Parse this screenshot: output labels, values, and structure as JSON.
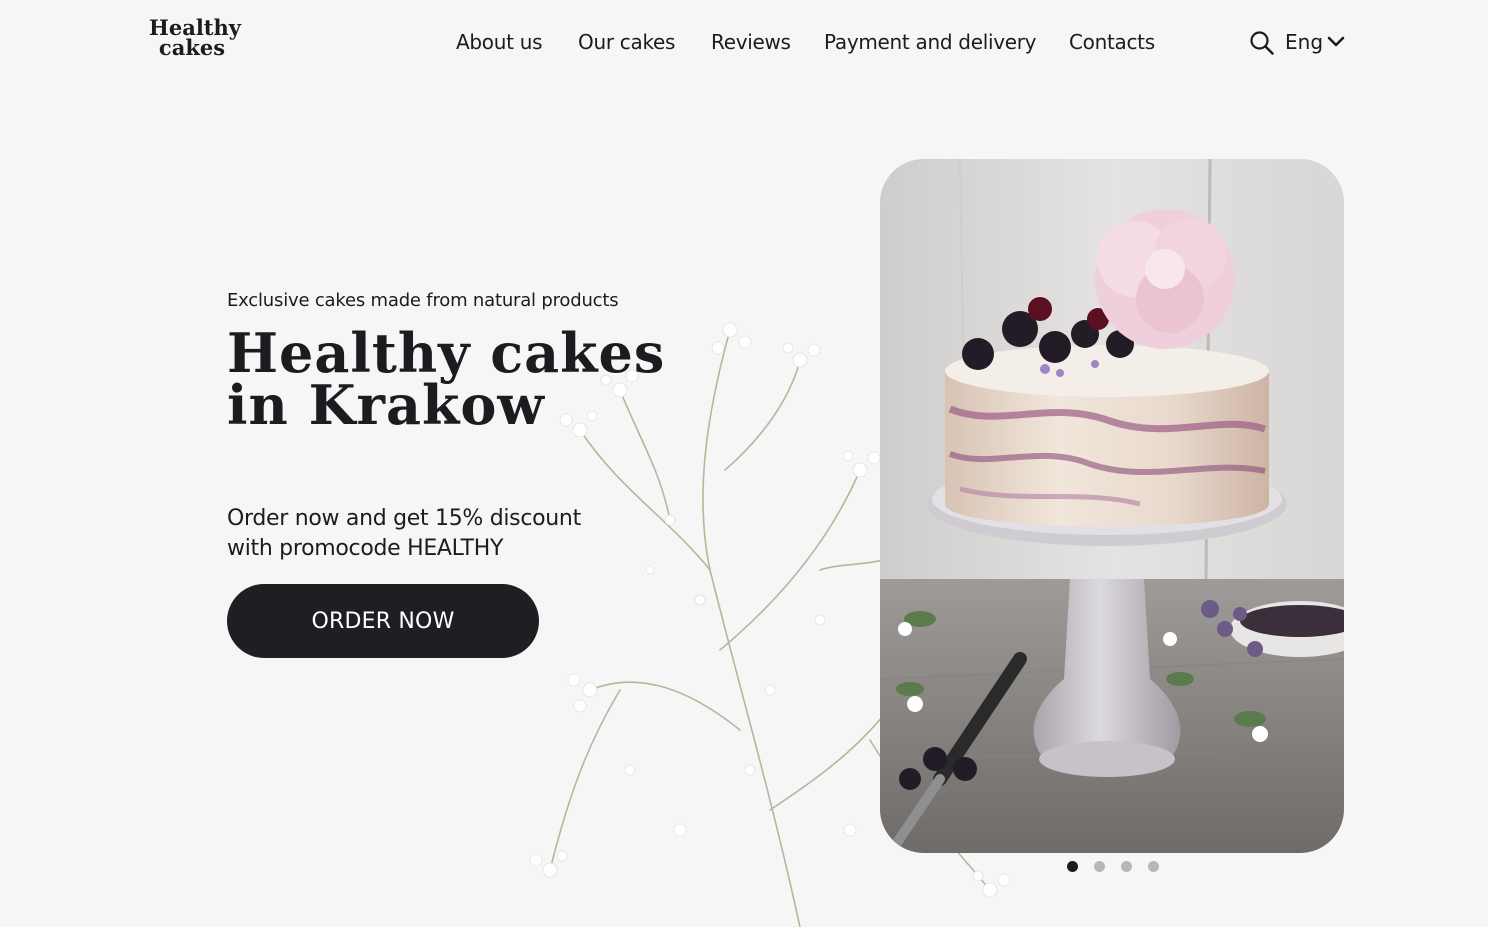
{
  "header": {
    "logo": {
      "line1": "Healthy",
      "line2": "cakes"
    },
    "nav": [
      "About us",
      "Our cakes",
      "Reviews",
      "Payment and delivery",
      "Contacts"
    ],
    "search_icon": "search-icon",
    "language": "Eng",
    "language_icon": "chevron-down-icon"
  },
  "hero": {
    "tagline": "Exclusive cakes  made from natural products",
    "headline": {
      "line1": "Healthy cakes",
      "line2": "in Krakow"
    },
    "promo": {
      "line1": "Order now and get 15% discount",
      "line2": "with promocode HEALTHY"
    },
    "cta": "ORDER NOW"
  },
  "carousel": {
    "slide_count": 4,
    "active_index": 0
  },
  "colors": {
    "text": "#1c1b1f",
    "button": "#1f1e22",
    "background": "#f6f6f6"
  }
}
